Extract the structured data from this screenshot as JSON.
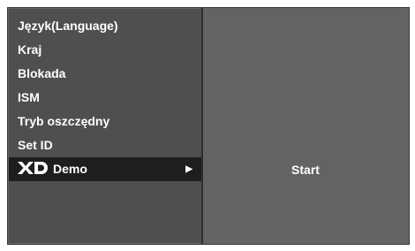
{
  "menu": {
    "items": [
      {
        "label": "Język(Language)"
      },
      {
        "label": "Kraj"
      },
      {
        "label": "Blokada"
      },
      {
        "label": "ISM"
      },
      {
        "label": "Tryb oszczędny"
      },
      {
        "label": "Set ID"
      },
      {
        "label": "Demo",
        "logo_text": "XD",
        "icon": "xd-logo-icon",
        "arrow_icon": "triangle-right-icon",
        "selected": true
      }
    ]
  },
  "submenu": {
    "value": "Start"
  },
  "colors": {
    "menu_bg": "#4f4f4f",
    "submenu_bg": "#636363",
    "selected_bg": "#1e1e1e",
    "text": "#ffffff"
  }
}
